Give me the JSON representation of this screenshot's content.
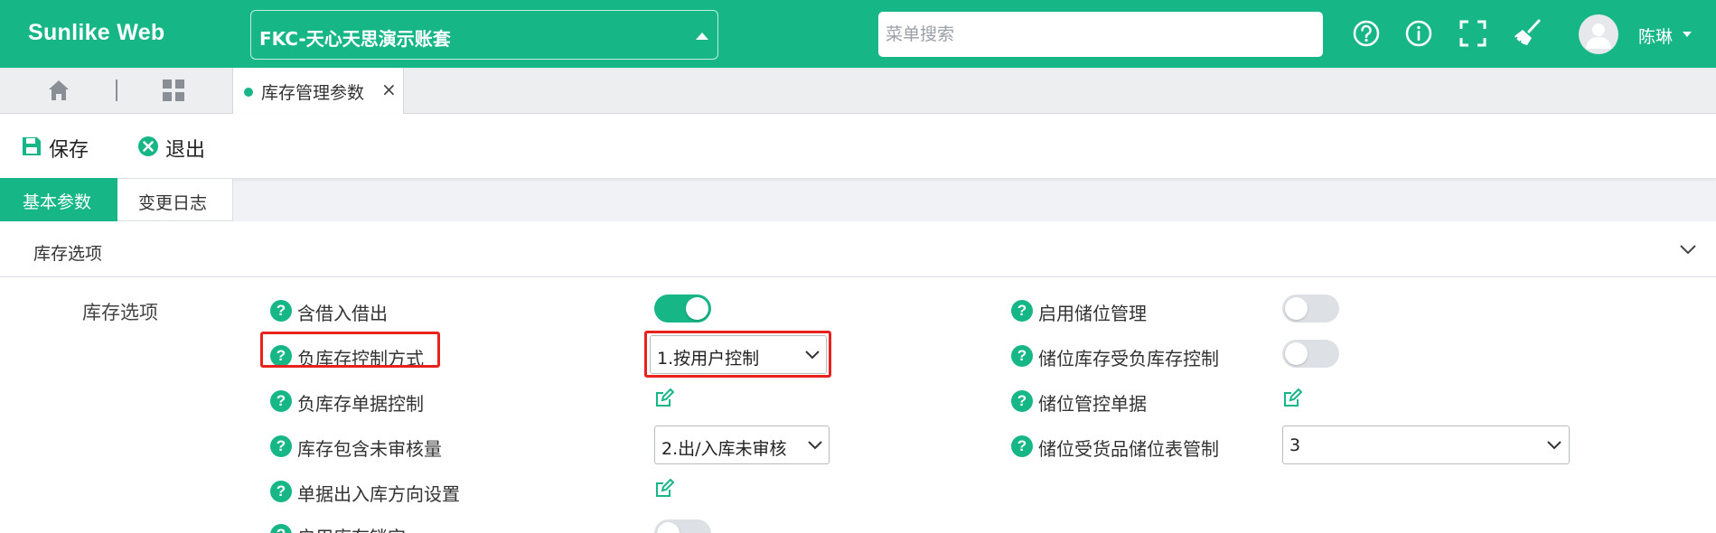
{
  "header": {
    "brand": "Sunlike Web",
    "account": "FKC-天心天思演示账套",
    "search_placeholder": "菜单搜索",
    "user": "陈琳",
    "icons": [
      "help-icon",
      "info-icon",
      "fullscreen-icon",
      "clean-icon"
    ]
  },
  "tabs": {
    "active_tab": "库存管理参数",
    "close_glyph": "×"
  },
  "toolbar": {
    "save": "保存",
    "exit": "退出"
  },
  "subtabs": {
    "basic": "基本参数",
    "log": "变更日志"
  },
  "section": {
    "title": "库存选项",
    "group_label": "库存选项"
  },
  "fields": {
    "borrow": {
      "label": "含借入借出",
      "enabled": true
    },
    "negative_mode": {
      "label": "负库存控制方式",
      "value": "1.按用户控制"
    },
    "negative_docs": {
      "label": "负库存单据控制"
    },
    "unaudited": {
      "label": "库存包含未审核量",
      "value": "2.出/入库未审核"
    },
    "direction": {
      "label": "单据出入库方向设置"
    },
    "partial_next": {
      "label": "启用库存锁定",
      "enabled": false
    },
    "bin_manage": {
      "label": "启用储位管理",
      "enabled": false
    },
    "bin_negative": {
      "label": "储位库存受负库存控制",
      "enabled": false
    },
    "bin_docs": {
      "label": "储位管控单据"
    },
    "bin_goods": {
      "label": "储位受货品储位表管制",
      "value": "3"
    }
  },
  "colors": {
    "accent": "#17b686",
    "highlight": "#e8221c"
  }
}
